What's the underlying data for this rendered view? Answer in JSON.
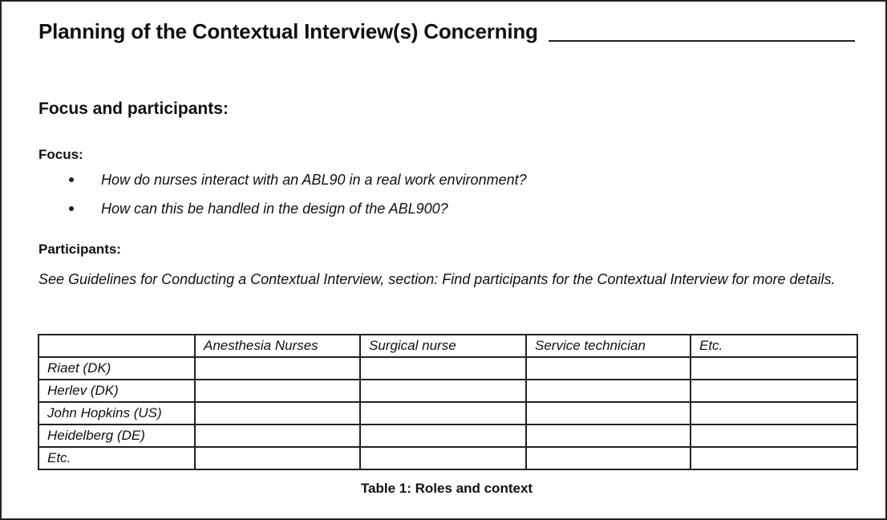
{
  "document": {
    "title": "Planning of the Contextual Interview(s) Concerning",
    "section_heading": "Focus and participants:",
    "focus": {
      "heading": "Focus:",
      "items": [
        "How do nurses interact with an ABL90 in a real work environment?",
        "How can this be handled in the design of the ABL900?"
      ]
    },
    "participants": {
      "heading": "Participants:",
      "text": "See Guidelines for Conducting a Contextual Interview, section: Find participants for the Contextual Interview for more details."
    },
    "table": {
      "columns": [
        "",
        "Anesthesia Nurses",
        "Surgical nurse",
        "Service technician",
        "Etc."
      ],
      "rows": [
        {
          "label": "Riaet (DK)",
          "cells": [
            "",
            "",
            "",
            ""
          ]
        },
        {
          "label": "Herlev (DK)",
          "cells": [
            "",
            "",
            "",
            ""
          ]
        },
        {
          "label": "John Hopkins (US)",
          "cells": [
            "",
            "",
            "",
            ""
          ]
        },
        {
          "label": "Heidelberg (DE)",
          "cells": [
            "",
            "",
            "",
            ""
          ]
        },
        {
          "label": "Etc.",
          "cells": [
            "",
            "",
            "",
            ""
          ]
        }
      ],
      "caption": "Table 1: Roles and context"
    }
  }
}
